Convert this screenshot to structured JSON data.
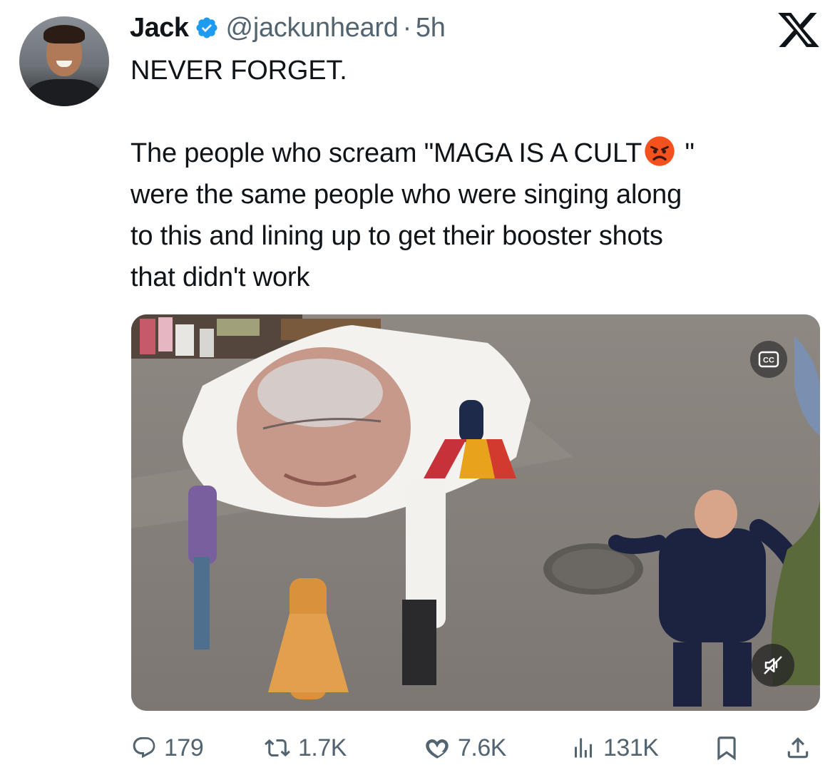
{
  "tweet": {
    "display_name": "Jack",
    "handle": "@jackunheard",
    "separator": "·",
    "time": "5h",
    "verified_color": "#1d9bf0",
    "text_line_1": "NEVER FORGET.",
    "text_body_before_emoji": "The people who scream \"MAGA IS A CULT",
    "emoji_name": "angry-face-emoji",
    "text_body_after_emoji": " \"\nwere the same people who were singing along\nto this and lining up to get their booster shots\nthat didn't work"
  },
  "brand": {
    "logo": "x-logo"
  },
  "media": {
    "type": "video",
    "controls": {
      "captions_icon": "cc-icon",
      "mute_icon": "speaker-muted-icon"
    }
  },
  "actions": {
    "replies": {
      "icon": "reply-icon",
      "count": "179"
    },
    "reposts": {
      "icon": "repost-icon",
      "count": "1.7K"
    },
    "likes": {
      "icon": "heart-icon",
      "count": "7.6K"
    },
    "views": {
      "icon": "views-chart-icon",
      "count": "131K"
    },
    "bookmark": {
      "icon": "bookmark-icon"
    },
    "share": {
      "icon": "share-icon"
    }
  },
  "colors": {
    "text_primary": "#0f1419",
    "text_secondary": "#536471",
    "accent": "#1d9bf0"
  }
}
